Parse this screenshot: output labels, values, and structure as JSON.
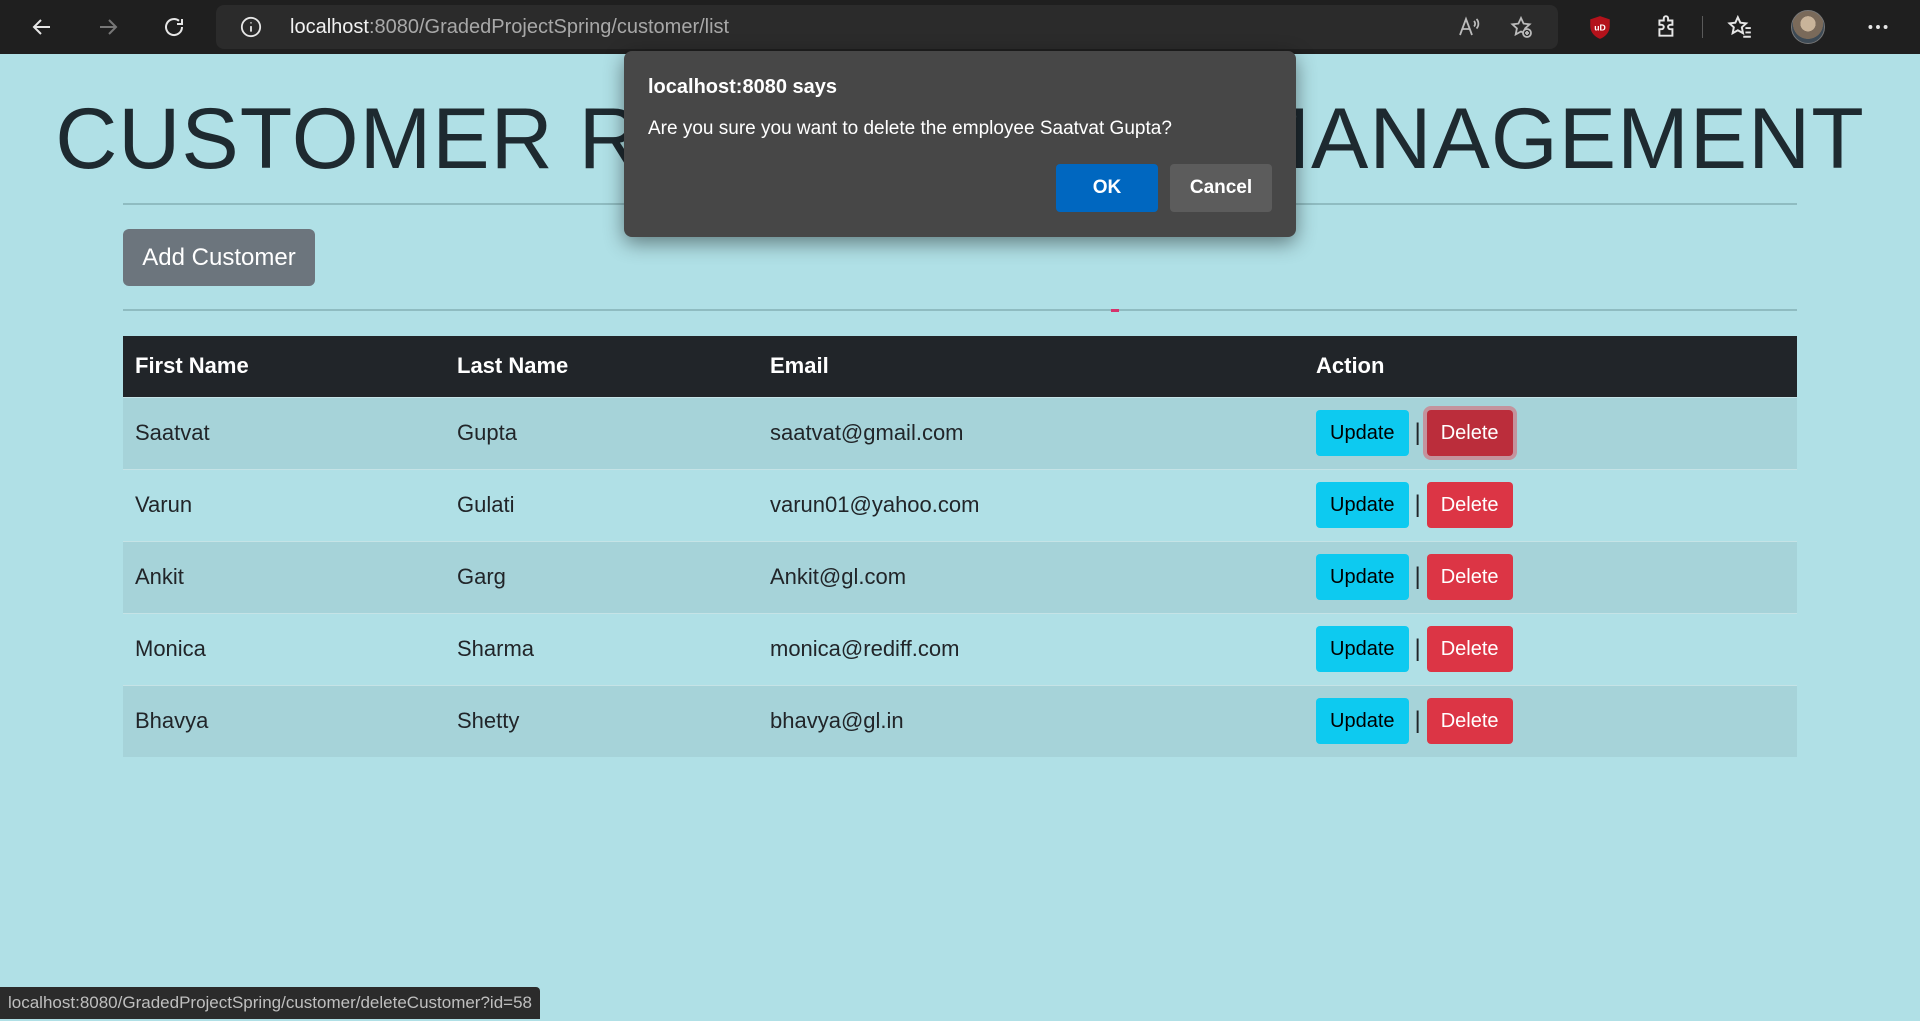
{
  "browser": {
    "url_host": "localhost",
    "url_rest": ":8080/GradedProjectSpring/customer/list",
    "status_url": "localhost:8080/GradedProjectSpring/customer/deleteCustomer?id=58"
  },
  "page": {
    "title": "CUSTOMER RELATIONSHIP MANAGEMENT",
    "add_button": "Add Customer"
  },
  "table": {
    "headers": [
      "First Name",
      "Last Name",
      "Email",
      "Action"
    ],
    "rows": [
      {
        "first": "Saatvat",
        "last": "Gupta",
        "email": "saatvat@gmail.com"
      },
      {
        "first": "Varun",
        "last": "Gulati",
        "email": "varun01@yahoo.com"
      },
      {
        "first": "Ankit",
        "last": "Garg",
        "email": "Ankit@gl.com"
      },
      {
        "first": "Monica",
        "last": "Sharma",
        "email": "monica@rediff.com"
      },
      {
        "first": "Bhavya",
        "last": "Shetty",
        "email": "bhavya@gl.in"
      }
    ],
    "update_label": "Update",
    "separator": "|",
    "delete_label": "Delete"
  },
  "dialog": {
    "title": "localhost:8080 says",
    "message": "Are you sure you want to delete the employee Saatvat Gupta?",
    "ok_label": "OK",
    "cancel_label": "Cancel"
  },
  "colors": {
    "page_bg": "#b0e0e6",
    "header_bg": "#212529",
    "update_btn": "#0dcaf0",
    "delete_btn": "#dc3545",
    "add_btn": "#6c757d",
    "dialog_ok": "#0067c0"
  }
}
